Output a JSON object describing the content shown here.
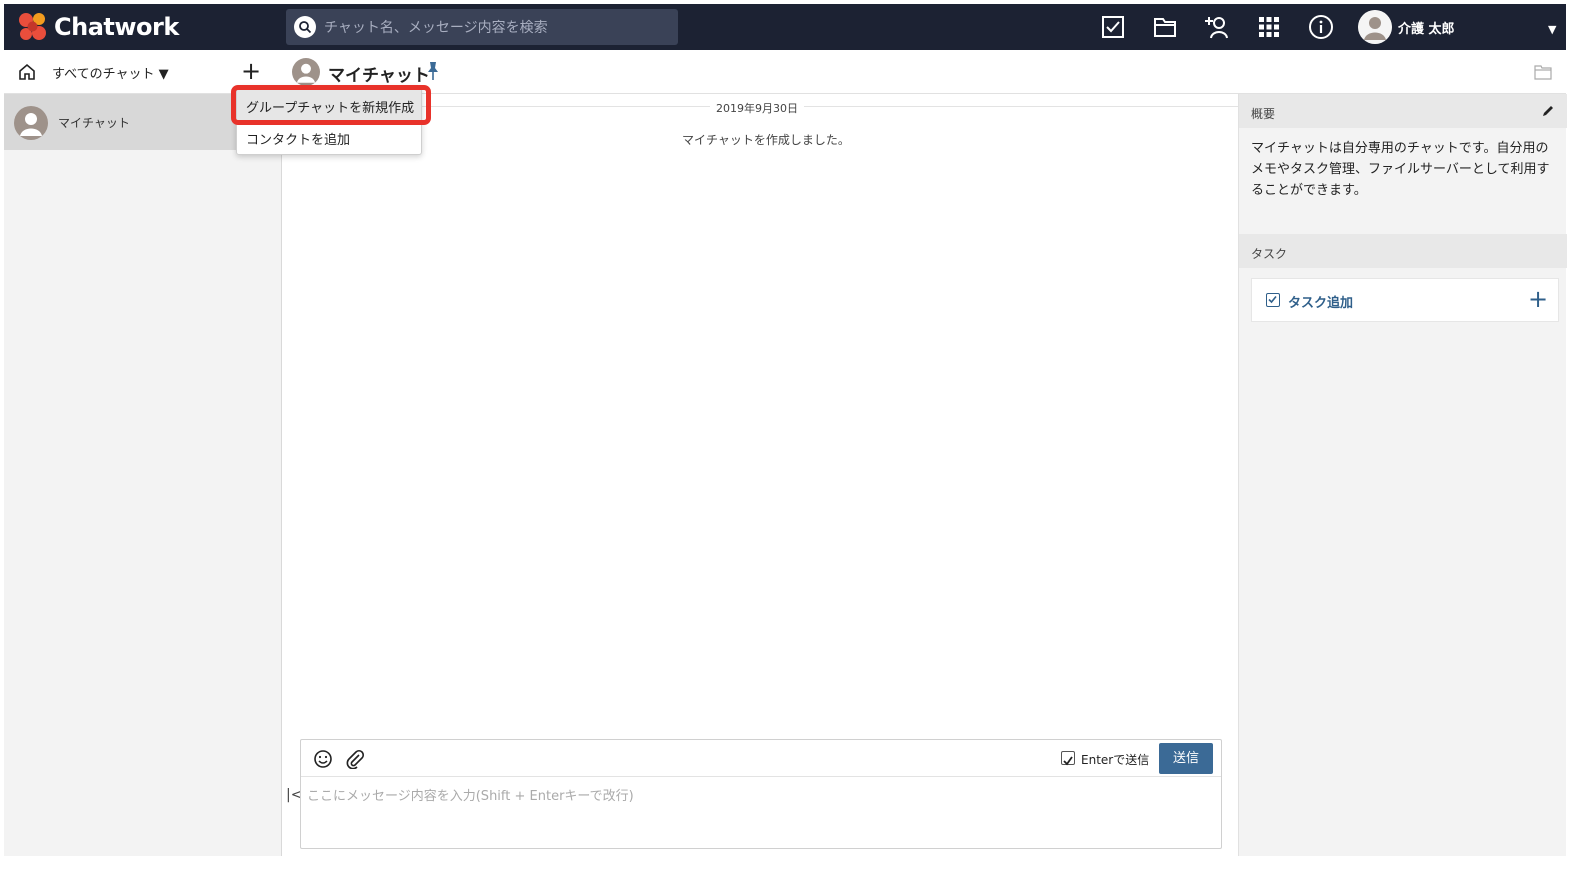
{
  "app": {
    "name": "Chatwork"
  },
  "search": {
    "placeholder": "チャット名、メッセージ内容を検索"
  },
  "header": {
    "icons": [
      "task-check-icon",
      "folder-icon",
      "add-contact-icon",
      "apps-grid-icon",
      "info-icon"
    ],
    "user_name": "介護 太郎"
  },
  "sidebar": {
    "filter_label": "すべてのチャット ▼",
    "add_label": "+",
    "items": [
      {
        "label": "マイチャット"
      }
    ]
  },
  "menu": {
    "items": [
      {
        "label": "グループチャットを新規作成"
      },
      {
        "label": "コンタクトを追加"
      }
    ]
  },
  "chat": {
    "title": "マイチャット",
    "date": "2019年9月30日",
    "messages": [
      {
        "text": "マイチャットを作成しました。"
      }
    ]
  },
  "composer": {
    "enter_label": "Enterで送信",
    "enter_checked": true,
    "send_label": "送信",
    "placeholder": "ここにメッセージ内容を入力(Shift + Enterキーで改行)"
  },
  "right_panel": {
    "overview_title": "概要",
    "overview_text": "マイチャットは自分専用のチャットです。自分用のメモやタスク管理、ファイルサーバーとして利用することができます。",
    "tasks_title": "タスク",
    "add_task_label": "タスク追加"
  },
  "colors": {
    "topbar": "#1c2233",
    "accent": "#3b6a96",
    "highlight_border": "#e8322a"
  }
}
